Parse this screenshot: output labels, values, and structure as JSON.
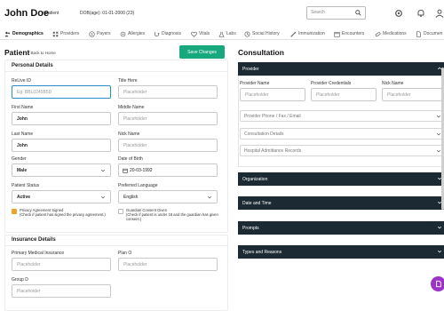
{
  "header": {
    "patient_name": "John Doe",
    "patient_tag": "/ Patient",
    "dob": "DOB(age): 01-01-2000 (23)",
    "search_placeholder": "Search"
  },
  "tabs": [
    {
      "label": "Demographics",
      "icon": "people-icon"
    },
    {
      "label": "Providers",
      "icon": "grid-icon"
    },
    {
      "label": "Payers",
      "icon": "dollar-icon"
    },
    {
      "label": "Allergies",
      "icon": "allergy-icon"
    },
    {
      "label": "Diagnosis",
      "icon": "stethoscope-icon"
    },
    {
      "label": "Vitals",
      "icon": "heart-icon"
    },
    {
      "label": "Labs",
      "icon": "flask-icon"
    },
    {
      "label": "Social History",
      "icon": "history-icon"
    },
    {
      "label": "Immunization",
      "icon": "syringe-icon"
    },
    {
      "label": "Encounters",
      "icon": "calendar-icon"
    },
    {
      "label": "Medications",
      "icon": "pill-icon"
    },
    {
      "label": "Documen",
      "icon": "document-icon"
    }
  ],
  "patient": {
    "title": "Patient",
    "back": "/ Back to Home",
    "save_label": "Save Changes",
    "personal_details_title": "Personal Details",
    "fields": {
      "relive_id": {
        "label": "ReLive ID",
        "value": "Eg: BBL0245B5D"
      },
      "title_here": {
        "label": "Title Here",
        "placeholder": "Placeholder"
      },
      "first_name": {
        "label": "First Name",
        "value": "John"
      },
      "middle_name": {
        "label": "Middle Name",
        "placeholder": "Placeholder"
      },
      "last_name": {
        "label": "Last Name",
        "value": "John"
      },
      "nick_name": {
        "label": "Nick Name",
        "placeholder": "Placeholder"
      },
      "gender": {
        "label": "Gender",
        "value": "Male"
      },
      "dob": {
        "label": "Date of Birth",
        "value": "20-03-1992"
      },
      "status": {
        "label": "Patient Status",
        "value": "Active"
      },
      "language": {
        "label": "Preferred Language",
        "value": "English"
      }
    },
    "privacy": {
      "title": "Privacy Agreement Signed",
      "note": "(Check if patient has signed the privacy agreement.)",
      "checked": true
    },
    "guardian": {
      "title": "Guardian Consent Given",
      "note": "(Check if patient is under 18 and the guardian has given consent.)",
      "checked": false
    },
    "insurance_title": "Insurance Details",
    "insurance": {
      "primary": {
        "label": "Primary Medical Insurance",
        "placeholder": "Placeholder"
      },
      "plan": {
        "label": "Plan O",
        "placeholder": "Placeholder"
      },
      "group": {
        "label": "Group D",
        "placeholder": "Placeholder"
      }
    }
  },
  "consultation": {
    "title": "Consultation",
    "provider_label": "Provider",
    "provider_fields": [
      {
        "label": "Provider Name",
        "placeholder": "Placeholder"
      },
      {
        "label": "Provider Credentials",
        "placeholder": "Placeholder"
      },
      {
        "label": "Nick Name",
        "placeholder": "Placeholder"
      }
    ],
    "lines": [
      "Provider Phone / Fax / Email",
      "Consultation Details",
      "Hospital Admittance Records"
    ],
    "sections": [
      "Organization",
      "Date and Time",
      "Prompts",
      "Types and Reasons"
    ]
  },
  "colors": {
    "accent": "#17a87e",
    "dark_bar": "#1b2a33",
    "checkbox": "#f0a32a",
    "fab": "#9c33c9"
  }
}
